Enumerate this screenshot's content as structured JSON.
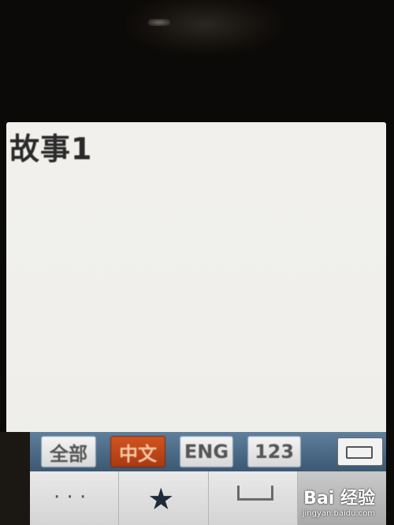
{
  "note": {
    "title": "故事1"
  },
  "ime": {
    "buttons": [
      {
        "label": "全部",
        "active": false
      },
      {
        "label": "中文",
        "active": true
      },
      {
        "label": "ENG",
        "active": false
      },
      {
        "label": "123",
        "active": false
      }
    ],
    "edit_icon": "keyboard-edit-icon"
  },
  "keys": {
    "row": [
      {
        "icon": "dots-icon"
      },
      {
        "icon": "star-icon"
      },
      {
        "icon": "space-icon"
      },
      {
        "icon": "delete-icon"
      }
    ]
  },
  "watermark": {
    "logo": "Bai 经验",
    "url": "jingyan.baidu.com"
  },
  "colors": {
    "ime_bar": "#4c6b87",
    "active_button": "#c2461a",
    "screen_bg": "#f0efeb"
  }
}
